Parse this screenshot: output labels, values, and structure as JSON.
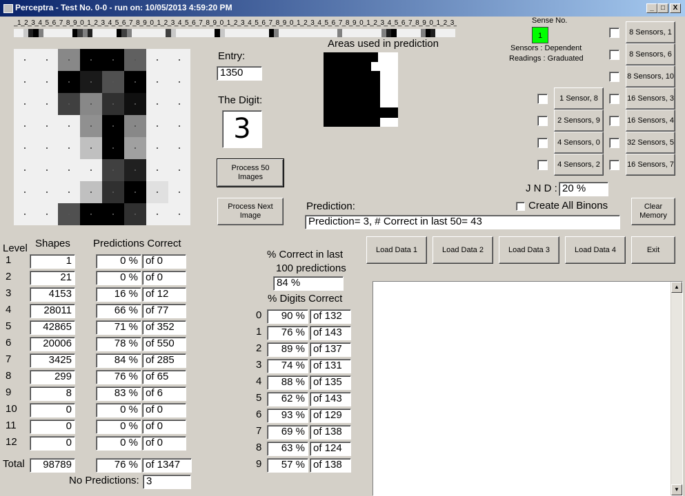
{
  "window": {
    "title": "Perceptra - Test No. 0-0 - run on: 10/05/2013  4:59:20 PM",
    "min": "_",
    "max": "□",
    "close": "X"
  },
  "ruler_text": "_1_2_3_4_5_6_7_8_9_0_1_2_3_4_5_6_7_8_9_0_1_2_3_4_5_6_7_8_9_0_1_2_3_4_5_6_7_8_9_0_1_2_3_4_5_6_7_8_9_0_1_2_3_4_5_6_7_8_9_0_1_2_3_4",
  "strip_colors": [
    "#f0f0f0",
    "#f0f0f0",
    "#c8c8c8",
    "#202020",
    "#000000",
    "#808080",
    "#f0f0f0",
    "#f0f0f0",
    "#f0f0f0",
    "#f0f0f0",
    "#f0f0f0",
    "#f0f0f0",
    "#000000",
    "#404040",
    "#808080",
    "#202020",
    "#f0f0f0",
    "#f0f0f0",
    "#f0f0f0",
    "#f0f0f0",
    "#f0f0f0",
    "#000000",
    "#404040",
    "#808080",
    "#f0f0f0",
    "#f0f0f0",
    "#f0f0f0",
    "#f0f0f0",
    "#f0f0f0",
    "#f0f0f0",
    "#f0f0f0",
    "#404040",
    "#c8c8c8",
    "#f0f0f0",
    "#f0f0f0",
    "#f0f0f0",
    "#f0f0f0",
    "#f0f0f0",
    "#f0f0f0",
    "#f0f0f0",
    "#f0f0f0",
    "#000000",
    "#c8c8c8",
    "#f0f0f0",
    "#f0f0f0",
    "#f0f0f0",
    "#f0f0f0",
    "#f0f0f0",
    "#f0f0f0",
    "#f0f0f0",
    "#f0f0f0",
    "#f0f0f0",
    "#000000",
    "#808080",
    "#f0f0f0",
    "#f0f0f0",
    "#f0f0f0",
    "#f0f0f0",
    "#f0f0f0",
    "#f0f0f0",
    "#f0f0f0",
    "#f0f0f0",
    "#f0f0f0",
    "#f0f0f0",
    "#f0f0f0",
    "#f0f0f0",
    "#808080",
    "#f0f0f0",
    "#f0f0f0",
    "#f0f0f0",
    "#f0f0f0",
    "#f0f0f0",
    "#f0f0f0",
    "#f0f0f0",
    "#f0f0f0",
    "#808080",
    "#202020",
    "#000000",
    "#f0f0f0",
    "#f0f0f0",
    "#f0f0f0",
    "#f0f0f0",
    "#f0f0f0",
    "#808080",
    "#000000",
    "#202020",
    "#f0f0f0",
    "#f0f0f0",
    "#f0f0f0",
    "#f0f0f0"
  ],
  "digit_image": [
    "#f0f0f0",
    "#f0f0f0",
    "#888888",
    "#000000",
    "#000000",
    "#606060",
    "#f0f0f0",
    "#f0f0f0",
    "#f0f0f0",
    "#f0f0f0",
    "#000000",
    "#1a1a1a",
    "#505050",
    "#000000",
    "#f0f0f0",
    "#f0f0f0",
    "#f0f0f0",
    "#f0f0f0",
    "#404040",
    "#888888",
    "#303030",
    "#101010",
    "#f0f0f0",
    "#f0f0f0",
    "#f0f0f0",
    "#f0f0f0",
    "#f0f0f0",
    "#909090",
    "#000000",
    "#888888",
    "#f0f0f0",
    "#f0f0f0",
    "#f0f0f0",
    "#f0f0f0",
    "#f0f0f0",
    "#c0c0c0",
    "#000000",
    "#a0a0a0",
    "#f0f0f0",
    "#f0f0f0",
    "#f0f0f0",
    "#f0f0f0",
    "#f0f0f0",
    "#f0f0f0",
    "#404040",
    "#202020",
    "#f0f0f0",
    "#f0f0f0",
    "#f0f0f0",
    "#f0f0f0",
    "#f0f0f0",
    "#c0c0c0",
    "#303030",
    "#000000",
    "#e0e0e0",
    "#f0f0f0",
    "#f0f0f0",
    "#f0f0f0",
    "#505050",
    "#000000",
    "#000000",
    "#303030",
    "#f0f0f0",
    "#f0f0f0"
  ],
  "entry": {
    "label": "Entry:",
    "value": "1350"
  },
  "digit": {
    "label": "The Digit:",
    "value": "3"
  },
  "areas_label": "Areas used in prediction",
  "sense": {
    "label": "Sense No.",
    "value": "1",
    "line1": "Sensors  :  Dependent",
    "line2": "Readings : Graduated"
  },
  "sensor_buttons": {
    "s8_1": "8 Sensors, 1",
    "s8_6": "8 Sensors, 6",
    "s8_10": "8 Sensors, 10",
    "s1_8": "1 Sensor, 8",
    "s16_3": "16 Sensors, 3",
    "s2_9": "2 Sensors, 9",
    "s16_4": "16 Sensors, 4",
    "s4_0": "4 Sensors, 0",
    "s32_5": "32 Sensors, 5",
    "s4_2": "4 Sensors, 2",
    "s16_7": "16 Sensors, 7"
  },
  "jnd": {
    "label": "J N D :",
    "value": "20 %"
  },
  "process50": "Process 50 Images",
  "process_next": "Process Next Image",
  "prediction": {
    "label": "Prediction:",
    "value": "Prediction= 3, # Correct in last 50= 43"
  },
  "create_all": "Create All Binons",
  "clear_memory": "Clear Memory",
  "load": [
    "Load Data 1",
    "Load Data 2",
    "Load Data 3",
    "Load Data 4"
  ],
  "exit": "Exit",
  "levels_header": {
    "level": "Level",
    "shapes": "Shapes",
    "preds": "Predictions Correct"
  },
  "levels": [
    {
      "n": "1",
      "shapes": "1",
      "pct": "0 %",
      "of": "of 0"
    },
    {
      "n": "2",
      "shapes": "21",
      "pct": "0 %",
      "of": "of 0"
    },
    {
      "n": "3",
      "shapes": "4153",
      "pct": "16 %",
      "of": "of 12"
    },
    {
      "n": "4",
      "shapes": "28011",
      "pct": "66 %",
      "of": "of 77"
    },
    {
      "n": "5",
      "shapes": "42865",
      "pct": "71 %",
      "of": "of 352"
    },
    {
      "n": "6",
      "shapes": "20006",
      "pct": "78 %",
      "of": "of 550"
    },
    {
      "n": "7",
      "shapes": "3425",
      "pct": "84 %",
      "of": "of 285"
    },
    {
      "n": "8",
      "shapes": "299",
      "pct": "76 %",
      "of": "of 65"
    },
    {
      "n": "9",
      "shapes": "8",
      "pct": "83 %",
      "of": "of 6"
    },
    {
      "n": "10",
      "shapes": "0",
      "pct": "0 %",
      "of": "of 0"
    },
    {
      "n": "11",
      "shapes": "0",
      "pct": "0 %",
      "of": "of 0"
    },
    {
      "n": "12",
      "shapes": "0",
      "pct": "0 %",
      "of": "of 0"
    }
  ],
  "total": {
    "label": "Total",
    "shapes": "98789",
    "pct": "76 %",
    "of": "of 1347"
  },
  "no_predictions": {
    "label": "No Predictions:",
    "value": "3"
  },
  "last100": {
    "line1": "% Correct in last",
    "line2": "100 predictions",
    "value": "84 %"
  },
  "digits_header": "% Digits Correct",
  "digits": [
    {
      "d": "0",
      "pct": "90 %",
      "of": "of 132"
    },
    {
      "d": "1",
      "pct": "76 %",
      "of": "of 143"
    },
    {
      "d": "2",
      "pct": "89 %",
      "of": "of 137"
    },
    {
      "d": "3",
      "pct": "74 %",
      "of": "of 131"
    },
    {
      "d": "4",
      "pct": "88 %",
      "of": "of 135"
    },
    {
      "d": "5",
      "pct": "62 %",
      "of": "of 143"
    },
    {
      "d": "6",
      "pct": "93 %",
      "of": "of 129"
    },
    {
      "d": "7",
      "pct": "69 %",
      "of": "of 138"
    },
    {
      "d": "8",
      "pct": "63 %",
      "of": "of 124"
    },
    {
      "d": "9",
      "pct": "57 %",
      "of": "of 138"
    }
  ],
  "scroll": {
    "up": "▲",
    "down": "▼"
  }
}
